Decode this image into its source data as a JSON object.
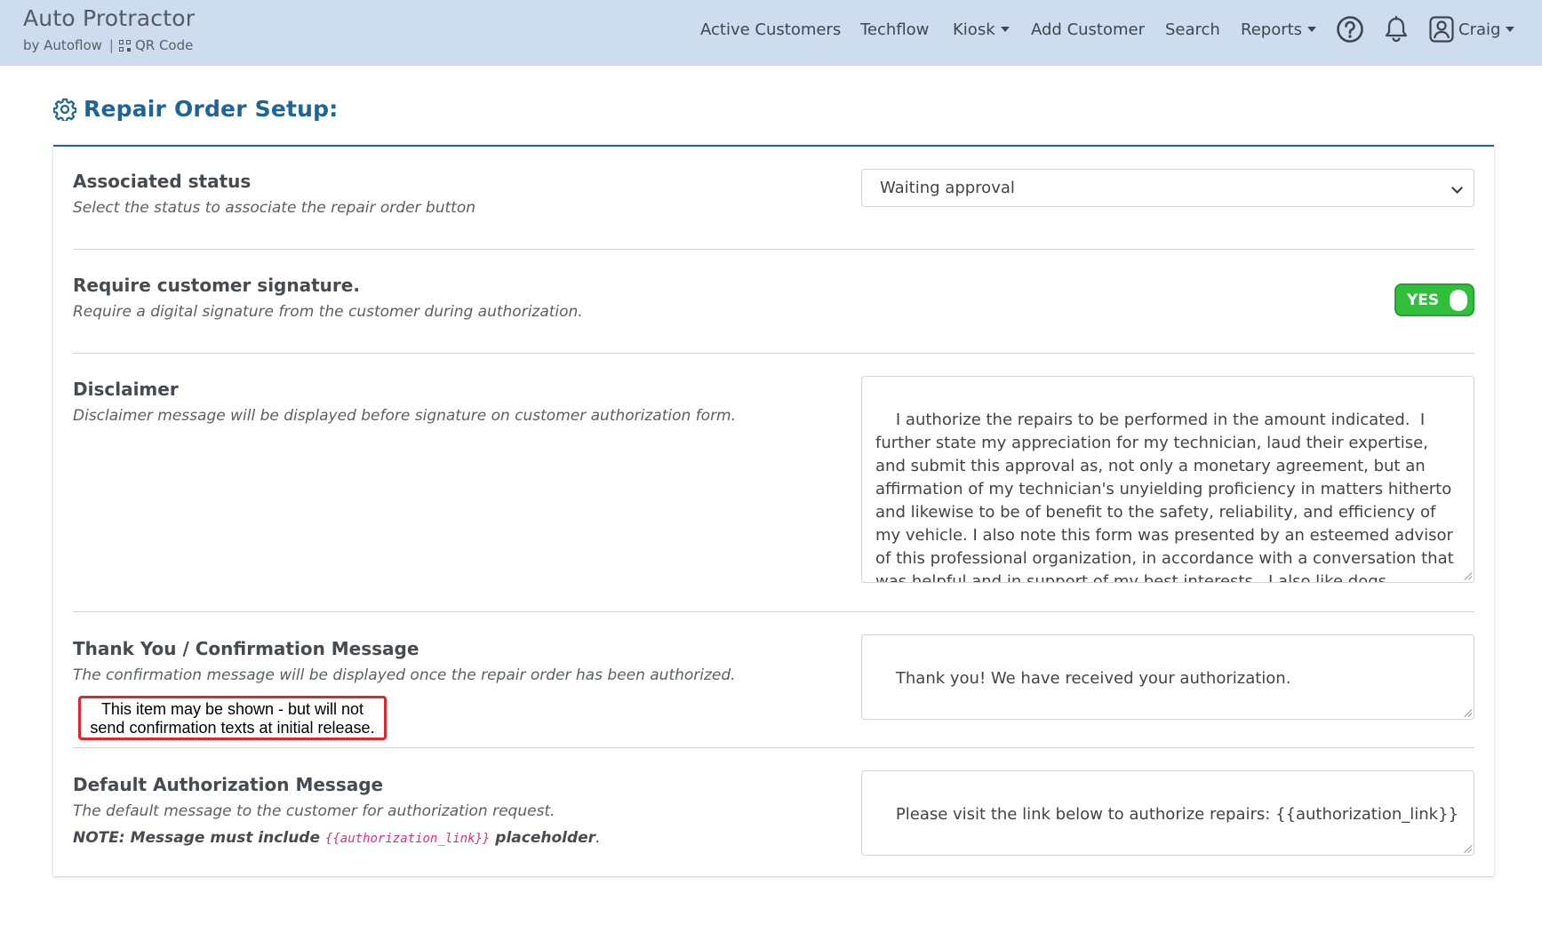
{
  "brand": {
    "title": "Auto Protractor",
    "byline": "by Autoflow",
    "separator": "|",
    "qr_label": "QR Code"
  },
  "nav": {
    "active_customers": "Active Customers",
    "techflow": "Techflow",
    "kiosk": "Kiosk",
    "add_customer": "Add Customer",
    "search": "Search",
    "reports": "Reports",
    "user": "Craig"
  },
  "page": {
    "title": "Repair Order Setup:"
  },
  "settings": {
    "associated_status": {
      "label": "Associated status",
      "help": "Select the status to associate the repair order button",
      "value": "Waiting approval"
    },
    "require_signature": {
      "label": "Require customer signature.",
      "help": "Require a digital signature from the customer during authorization.",
      "toggle_label": "YES",
      "enabled": true
    },
    "disclaimer": {
      "label": "Disclaimer",
      "help": "Disclaimer message will be displayed before signature on customer authorization form.",
      "value": "I authorize the repairs to be performed in the amount indicated.  I further state my appreciation for my technician, laud their expertise, and submit this approval as, not only a monetary agreement, but an affirmation of my technician's unyielding proficiency in matters hitherto and likewise to be of benefit to the safety, reliability, and efficiency of my vehicle. I also note this form was presented by an esteemed advisor of this professional organization, in accordance with a conversation that was helpful and in support of my best interests.  I also like dogs."
    },
    "thank_you": {
      "label": "Thank You / Confirmation Message",
      "help": "The confirmation message will be displayed once the repair order has been authorized.",
      "callout_line1": "This item may be shown - but will not",
      "callout_line2": "send confirmation texts at initial release.",
      "value": "Thank you! We have received your authorization."
    },
    "default_authorization": {
      "label": "Default Authorization Message",
      "help": "The default message to the customer for authorization request.",
      "note_prefix": "NOTE: Message must include",
      "note_code": "{{authorization_link}}",
      "note_suffix": "placeholder",
      "note_end": ".",
      "value": "Please visit the link below to authorize repairs: {{authorization_link}}"
    }
  },
  "colors": {
    "navbar_bg": "#cddcee",
    "title_blue": "#1f6496",
    "toggle_green": "#2fbf3a",
    "callout_red": "#e0262b",
    "code_pink": "#d63384"
  },
  "icons": [
    "qr-code-icon",
    "gear-icon",
    "help-circle-icon",
    "bell-icon",
    "user-icon",
    "chevron-down-icon"
  ]
}
